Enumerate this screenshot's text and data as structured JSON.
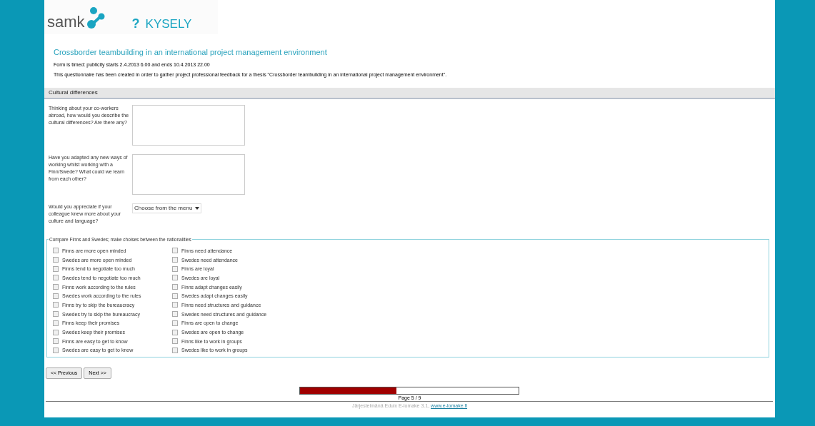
{
  "header": {
    "logo_text": "samk",
    "logo_mark": "?",
    "app_name": "KYSELY"
  },
  "survey": {
    "title": "Crossborder teambuilding in an international project management environment",
    "timing": "Form is timed: publicity starts 2.4.2013 6.00 and ends 10.4.2013 22.00",
    "description": "This questionnaire has been created in order to gather project professional feedback for a thesis \"Crossborder teambuilding in an international project management environment\"."
  },
  "section": {
    "title": "Cultural differences"
  },
  "questions": [
    {
      "kind": "textarea",
      "label": "Thinking about your co-workers abroad, how would you describe the cultural differences? Are there any?"
    },
    {
      "kind": "textarea",
      "label": "Have you adapted any new ways of working whilst working with a Finn/Swede? What could we learn from each other?"
    },
    {
      "kind": "select",
      "label": "Would you appreciate if your colleague knew more about your culture and language?",
      "value": "Choose from the menu"
    }
  ],
  "fieldset": {
    "legend": "Compare Finns and Swedes; make choises between the nationalities",
    "columns": [
      [
        {
          "label": "Finns are more open minded",
          "checked": false
        },
        {
          "label": "Swedes are more open minded",
          "checked": false
        },
        {
          "label": "Finns tend to negotiate too much",
          "checked": false
        },
        {
          "label": "Swedes tend to negotiate too much",
          "checked": false
        },
        {
          "label": "Finns work according to the rules",
          "checked": false
        },
        {
          "label": "Swedes work according to the rules",
          "checked": false
        },
        {
          "label": "Finns try to skip the bureaucracy",
          "checked": false
        },
        {
          "label": "Swedes try to skip the bureaucracy",
          "checked": false
        },
        {
          "label": "Finns keep their promises",
          "checked": false
        },
        {
          "label": "Swedes keep their promises",
          "checked": false
        },
        {
          "label": "Finns are easy to get to know",
          "checked": false
        },
        {
          "label": "Swedes are easy to get to know",
          "checked": false
        }
      ],
      [
        {
          "label": "Finns need attendance",
          "checked": false
        },
        {
          "label": "Swedes need attendance",
          "checked": false
        },
        {
          "label": "Finns are loyal",
          "checked": false
        },
        {
          "label": "Swedes are loyal",
          "checked": false
        },
        {
          "label": "Finns adapt changes easily",
          "checked": false
        },
        {
          "label": "Swedes adapt changes easily",
          "checked": false
        },
        {
          "label": "Finns need structures and guidance",
          "checked": false
        },
        {
          "label": "Swedes need structures and guidance",
          "checked": false
        },
        {
          "label": "Finns are open to change",
          "checked": false
        },
        {
          "label": "Swedes are open to change",
          "checked": false
        },
        {
          "label": "Finns like to work in groups",
          "checked": false
        },
        {
          "label": "Swedes like to work in groups",
          "checked": false
        }
      ]
    ]
  },
  "navigation": {
    "buttons": [
      "<< Previous",
      "Next >>"
    ]
  },
  "progress": {
    "level": 0.44,
    "label": "Page 5 / 9"
  },
  "footer": {
    "text": "Järjestelmänä Eduix E-lomake 3.1,",
    "link": "www.e-lomake.fi"
  }
}
